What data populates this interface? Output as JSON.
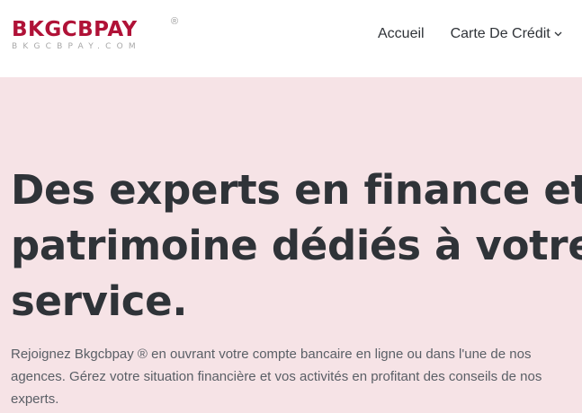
{
  "brand": {
    "name": "BKGCBPAY",
    "registered": "®",
    "domain": "BKGCBPAY.COM",
    "color": "#b01237"
  },
  "nav": {
    "items": [
      {
        "label": "Accueil"
      },
      {
        "label": "Carte De Crédit",
        "icon": "chevron-down-icon"
      }
    ]
  },
  "hero": {
    "title_lines": [
      "Des experts en finance et",
      "patrimoine dédiés à votre",
      "service."
    ],
    "text": "Rejoignez Bkgcbpay ® en ouvrant votre compte bancaire en ligne ou dans l'une de nos agences. Gérez votre situation financière et vos activités en profitant des conseils de nos experts.",
    "background": "#f6e3e6"
  }
}
